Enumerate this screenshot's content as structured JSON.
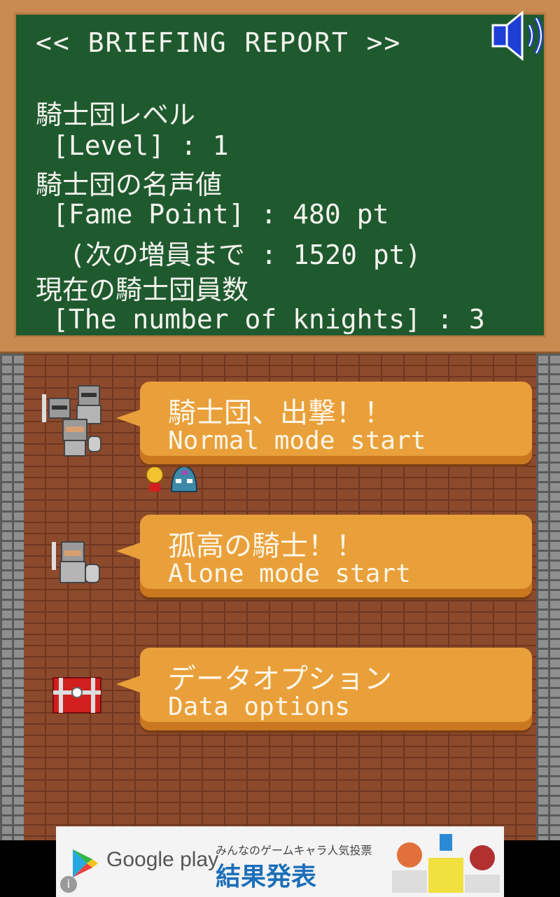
{
  "briefing": {
    "title": "<< BRIEFING REPORT >>",
    "level_jp": "騎士団レベル",
    "level_en": "[Level] : 1",
    "fame_jp": "騎士団の名声値",
    "fame_en": "[Fame Point] : 480 pt",
    "next_jp": "(次の増員まで : 1520 pt)",
    "knights_jp": "現在の騎士団員数",
    "knights_en": "[The number of knights] : 3"
  },
  "sound": {
    "icon": "speaker-icon",
    "state": "on"
  },
  "menu": [
    {
      "jp": "騎士団、出撃！！",
      "en": "Normal mode start",
      "icon": "knight-party-icon"
    },
    {
      "jp": "孤高の騎士！！",
      "en": "Alone mode start",
      "icon": "lone-knight-icon"
    },
    {
      "jp": "データオプション",
      "en": "Data options",
      "icon": "treasure-chest-icon"
    }
  ],
  "ad": {
    "brand": "Google play",
    "headline_small": "みんなのゲームキャラ人気投票",
    "headline_big": "結果発表",
    "info": "i"
  },
  "colors": {
    "board": "#1f5a2f",
    "frame": "#c98a52",
    "button": "#e9a03a",
    "brick": "#8c4a2c",
    "stone": "#8f8f8f"
  }
}
